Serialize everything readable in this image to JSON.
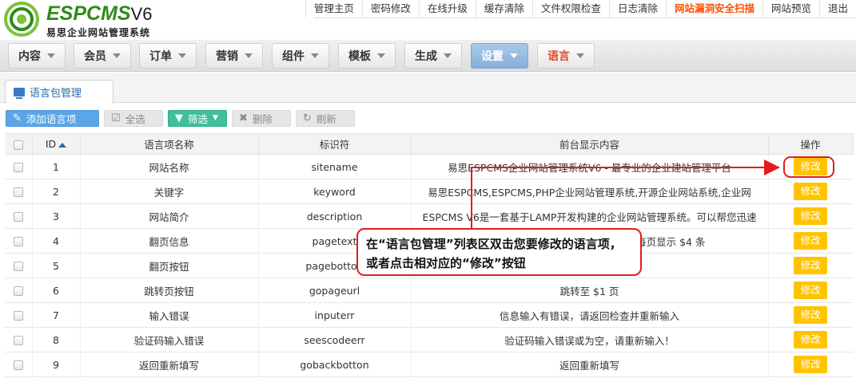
{
  "brand": {
    "name": "ESPCMS",
    "version": "V6",
    "subtitle": "易思企业网站管理系统"
  },
  "top_links": [
    {
      "label": "管理主页",
      "highlight": false
    },
    {
      "label": "密码修改",
      "highlight": false
    },
    {
      "label": "在线升级",
      "highlight": false
    },
    {
      "label": "缓存清除",
      "highlight": false
    },
    {
      "label": "文件权限检查",
      "highlight": false
    },
    {
      "label": "日志清除",
      "highlight": false
    },
    {
      "label": "网站漏洞安全扫描",
      "highlight": true
    },
    {
      "label": "网站预览",
      "highlight": false
    },
    {
      "label": "退出",
      "highlight": false
    }
  ],
  "main_tabs": [
    {
      "label": "内容",
      "state": "normal"
    },
    {
      "label": "会员",
      "state": "normal"
    },
    {
      "label": "订单",
      "state": "normal"
    },
    {
      "label": "营销",
      "state": "normal"
    },
    {
      "label": "组件",
      "state": "normal"
    },
    {
      "label": "模板",
      "state": "normal"
    },
    {
      "label": "生成",
      "state": "normal"
    },
    {
      "label": "设置",
      "state": "active"
    },
    {
      "label": "语言",
      "state": "lang"
    }
  ],
  "panel_tab": {
    "label": "语言包管理"
  },
  "toolbar": {
    "add": "添加语言项",
    "select_all": "全选",
    "filter": "筛选",
    "delete": "删除",
    "refresh": "刷新"
  },
  "table": {
    "headers": {
      "id": "ID",
      "name": "语言项名称",
      "key": "标识符",
      "content": "前台显示内容",
      "action": "操作"
    },
    "action_label": "修改",
    "rows": [
      {
        "id": "1",
        "name": "网站名称",
        "key": "sitename",
        "content": "易思ESPCMS企业网站管理系统V6 - 最专业的企业建站管理平台"
      },
      {
        "id": "2",
        "name": "关键字",
        "key": "keyword",
        "content": "易思ESPCMS,ESPCMS,PHP企业网站管理系统,开源企业网站系统,企业网"
      },
      {
        "id": "3",
        "name": "网站简介",
        "key": "description",
        "content": "ESPCMS V6是一套基于LAMP开发构建的企业网站管理系统。可以帮您迅速"
      },
      {
        "id": "4",
        "name": "翻页信息",
        "key": "pagetext",
        "content": "共有记录 $1 条，每页显示 $4 条"
      },
      {
        "id": "5",
        "name": "翻页按钮",
        "key": "pagebotton",
        "content": ""
      },
      {
        "id": "6",
        "name": "跳转页按钮",
        "key": "gopageurl",
        "content": "跳转至 $1 页"
      },
      {
        "id": "7",
        "name": "输入错误",
        "key": "inputerr",
        "content": "信息输入有错误，请返回检查并重新输入"
      },
      {
        "id": "8",
        "name": "验证码输入错误",
        "key": "seescodeerr",
        "content": "验证码输入错误或为空，请重新输入！"
      },
      {
        "id": "9",
        "name": "返回重新填写",
        "key": "gobackbotton",
        "content": "返回重新填写"
      }
    ]
  },
  "annotation": {
    "text": "在“语言包管理”列表区双击您要修改的语言项，或者点击相对应的“修改”按钮",
    "color": "#e21d1d"
  }
}
